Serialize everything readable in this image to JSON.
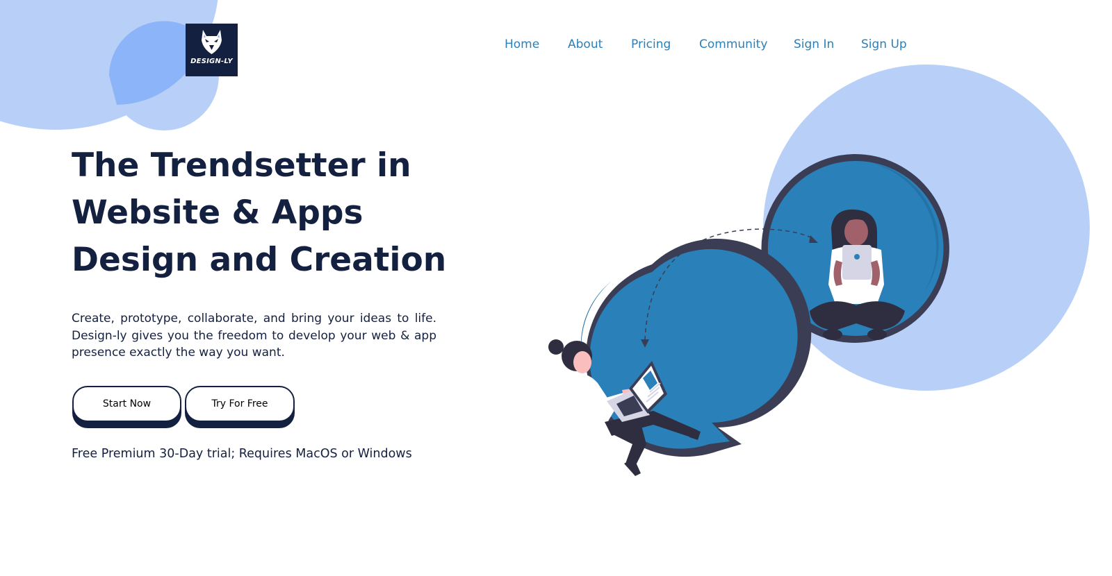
{
  "brand": {
    "logo_text": "DESIGN-LY"
  },
  "nav": {
    "items": [
      {
        "label": "Home"
      },
      {
        "label": "About"
      },
      {
        "label": "Pricing"
      },
      {
        "label": "Community"
      },
      {
        "label": "Sign In"
      },
      {
        "label": "Sign Up"
      }
    ]
  },
  "hero": {
    "title_lines": [
      "The Trendsetter in",
      "Website & Apps",
      "Design and Creation"
    ],
    "description": "Create, prototype, collaborate, and bring your ideas to life. Design-ly gives you the freedom to develop your web & app presence exactly the way you want.",
    "primary_button": "Start Now",
    "secondary_button": "Try For Free",
    "trial_note": "Free Premium 30-Day trial; Requires MacOS or Windows"
  },
  "colors": {
    "dark_navy": "#14203f",
    "nav_link": "#2c7fb8",
    "light_blue_blob": "#b8d0f8",
    "medium_blue_blob": "#8cb4f8",
    "bubble_fill": "#2a80b9",
    "bubble_outline": "#3b3d55"
  },
  "icons": {
    "logo": "wolf-head-icon",
    "illustration": "people-chatting-illustration"
  }
}
